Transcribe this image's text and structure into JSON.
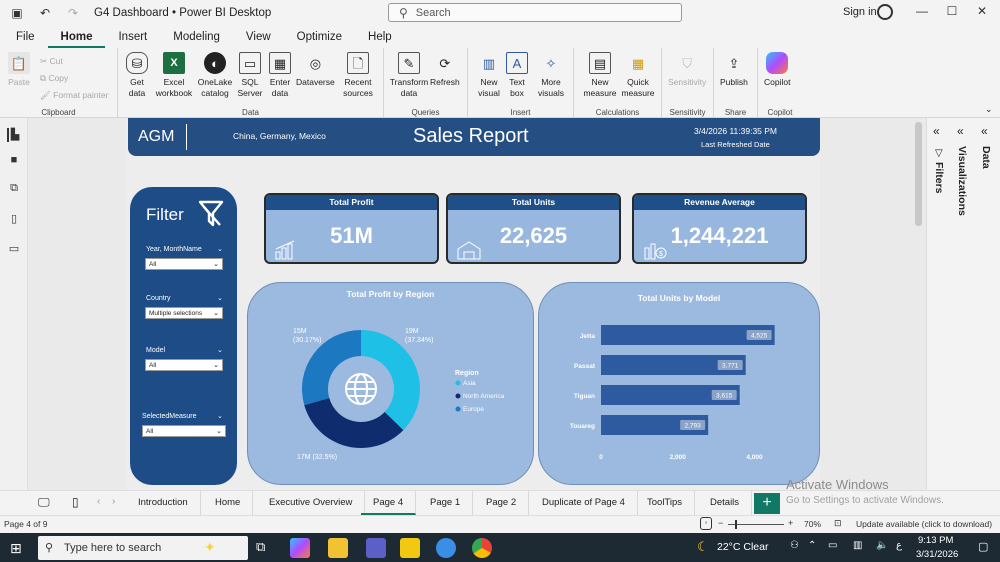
{
  "titlebar": {
    "title": "G4 Dashboard • Power BI Desktop",
    "search_placeholder": "Search",
    "signin": "Sign in"
  },
  "menu": {
    "tabs": [
      "File",
      "Home",
      "Insert",
      "Modeling",
      "View",
      "Optimize",
      "Help"
    ],
    "active": "Home"
  },
  "ribbon": {
    "clipboard": {
      "paste": "Paste",
      "cut": "Cut",
      "copy": "Copy",
      "format_painter": "Format painter",
      "label": "Clipboard"
    },
    "data": {
      "get_data": "Get data",
      "excel": "Excel workbook",
      "onelake": "OneLake catalog",
      "sql": "SQL Server",
      "enter": "Enter data",
      "dataverse": "Dataverse",
      "recent": "Recent sources",
      "label": "Data"
    },
    "queries": {
      "transform": "Transform data",
      "refresh": "Refresh",
      "label": "Queries"
    },
    "insert": {
      "new_visual": "New visual",
      "text_box": "Text box",
      "more_visuals": "More visuals",
      "label": "Insert"
    },
    "calculations": {
      "new_measure": "New measure",
      "quick_measure": "Quick measure",
      "label": "Calculations"
    },
    "sensitivity": {
      "sensitivity": "Sensitivity",
      "label": "Sensitivity"
    },
    "share": {
      "publish": "Publish",
      "label": "Share"
    },
    "copilot": {
      "copilot": "Copilot",
      "label": "Copilot"
    }
  },
  "report": {
    "brand": "AGM",
    "countries": "China, Germany, Mexico",
    "title": "Sales Report",
    "date": "3/4/2026 11:39:35 PM",
    "refresh_label": "Last Refreshed Date",
    "filter_title": "Filter",
    "slicers": [
      {
        "label": "Year, MonthName",
        "value": "All"
      },
      {
        "label": "Country",
        "value": "Multiple selections"
      },
      {
        "label": "Model",
        "value": "All"
      },
      {
        "label": "SelectedMeasure",
        "value": "All"
      }
    ],
    "kpis": [
      {
        "label": "Total Profit",
        "value": "51M"
      },
      {
        "label": "Total Units",
        "value": "22,625"
      },
      {
        "label": "Revenue Average",
        "value": "1,244,221"
      }
    ],
    "legend_title": "Region"
  },
  "chart_data": [
    {
      "type": "pie",
      "title": "Total Profit by Region",
      "categories": [
        "Asia",
        "North America",
        "Europe"
      ],
      "values": [
        19,
        17,
        15
      ],
      "labels": [
        "19M\n(37.34%)",
        "17M (32.5%)",
        "15M\n(30.17%)"
      ],
      "colors": [
        "#1ec0e6",
        "#0f2d6e",
        "#1d78c2"
      ],
      "legend": "right"
    },
    {
      "type": "bar",
      "title": "Total Units by Model",
      "categories": [
        "Jetta",
        "Passat",
        "Tiguan",
        "Touareg"
      ],
      "values": [
        4525,
        3771,
        3615,
        2793
      ],
      "value_labels": [
        "4,525",
        "3,771",
        "3,615",
        "2,793"
      ],
      "xticks": [
        "0",
        "2,000",
        "4,000"
      ],
      "xlim": [
        0,
        4900
      ],
      "color": "#2e5aa0"
    }
  ],
  "page_tabs": [
    "Introduction",
    "Home",
    "Executive Overview",
    "Page 4",
    "Page 1",
    "Page 2",
    "Duplicate of Page 4",
    "ToolTips",
    "Details"
  ],
  "active_tab": "Page 4",
  "status": {
    "page": "Page 4 of 9",
    "zoom": "70%",
    "update": "Update available (click to download)"
  },
  "right_pane": {
    "filters": "Filters",
    "visualizations": "Visualizations",
    "data": "Data"
  },
  "watermark": {
    "line1": "Activate Windows",
    "line2": "Go to Settings to activate Windows."
  },
  "taskbar": {
    "search_placeholder": "Type here to search",
    "weather": "22°C  Clear",
    "time": "9:13 PM",
    "date": "3/31/2026"
  }
}
